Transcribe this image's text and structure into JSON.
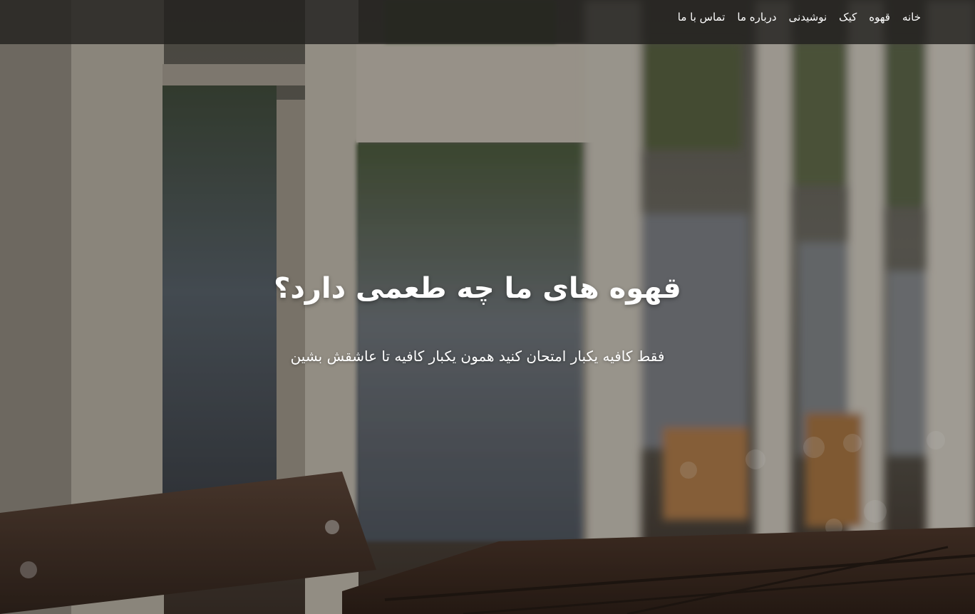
{
  "nav": {
    "items": [
      {
        "label": "خانه"
      },
      {
        "label": "قهوه"
      },
      {
        "label": "کیک"
      },
      {
        "label": "نوشیدنی"
      },
      {
        "label": "درباره ما"
      },
      {
        "label": "تماس با ما"
      }
    ]
  },
  "hero": {
    "title": "قهوه های ما چه طعمی دارد؟",
    "subtitle": "فقط کافیه یکبار امتحان کنید همون یکبار کافیه تا عاشقش بشین",
    "background": "cafe-window-table-photo"
  },
  "colors": {
    "navbar": "#22211e",
    "text": "#ffffff"
  }
}
